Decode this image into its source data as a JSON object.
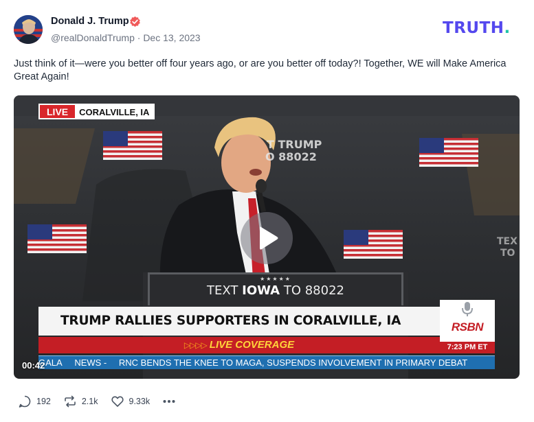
{
  "post": {
    "author": {
      "name": "Donald J. Trump",
      "handle": "@realDonaldTrump",
      "separator": "·",
      "date": "Dec 13, 2023"
    },
    "brand": {
      "text": "TRUTH",
      "dot": ".",
      "color": "#5448ee",
      "dot_color": "#21c4a8"
    },
    "text": "Just think of it—were you better off four years ago, or are you better off today?! Together, WE will Make America Great Again!"
  },
  "video": {
    "live_label": "LIVE",
    "location": "CORALVILLE, IA",
    "backdrop_line1": "T TRUMP",
    "backdrop_line2": "O 88022",
    "backdrop_right_line1": "TEX",
    "backdrop_right_line2": "TO",
    "podium_stars": "★★★★★",
    "podium_pre": "TEXT ",
    "podium_bold": "IOWA",
    "podium_post": " TO 88022",
    "headline": "TRUMP RALLIES SUPPORTERS IN CORALVILLE, IA",
    "coverage_arrows": "▷▷▷▷",
    "coverage": "LIVE COVERAGE",
    "network": "RSBN",
    "network_time": "7:23 PM ET",
    "ticker": [
      "GALA",
      "NEWS -",
      "RNC BENDS THE KNEE TO MAGA, SUSPENDS INVOLVEMENT IN PRIMARY DEBAT"
    ],
    "elapsed": "00:42",
    "play_icon": "play-icon"
  },
  "actions": {
    "replies": "192",
    "retruths": "2.1k",
    "likes": "9.33k",
    "more_icon": "more-dots-icon"
  },
  "colors": {
    "verified": "#f05a5a",
    "live_red": "#d9262b",
    "ticker_blue": "#1f6fb0"
  }
}
